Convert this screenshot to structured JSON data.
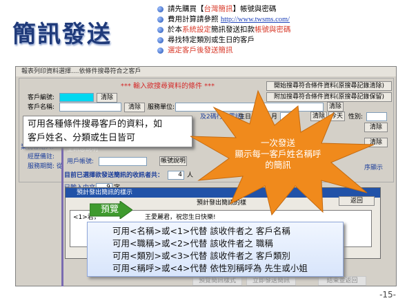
{
  "slide": {
    "title": "簡訊發送",
    "page_number": "-15-",
    "bullets": [
      {
        "parts": [
          {
            "t": "請先購買【"
          },
          {
            "t": "台灣簡訊",
            "c": "red"
          },
          {
            "t": "】帳號與密碼"
          }
        ]
      },
      {
        "parts": [
          {
            "t": "費用計算請參照 "
          },
          {
            "t": "http://www.twsms.com/",
            "c": "link"
          }
        ]
      },
      {
        "parts": [
          {
            "t": "於本"
          },
          {
            "t": "系統設定",
            "c": "red"
          },
          {
            "t": "簡訊發送扣款"
          },
          {
            "t": "帳號與密碼",
            "c": "red"
          }
        ]
      },
      {
        "parts": [
          {
            "t": "尋找特定類別或生日的客戶"
          }
        ]
      },
      {
        "parts": [
          {
            "t": "選定客戶後發送簡訊",
            "c": "red"
          }
        ]
      }
    ]
  },
  "window": {
    "title": "報表列印資料選擇....依條件搜尋符合之客戶",
    "header": "***  輸入欲搜尋資料的條件  ***",
    "btn_search_clear": "開始搜尋符合條件資料(原搜尋記錄清除)",
    "btn_search_keep": "附加搜尋符合條件資料(原搜尋記錄保留)",
    "customer_id_label": "客戶編號:",
    "customer_name_label": "客戶名稱:",
    "clear_label": "清除",
    "service_unit_label": "服務單位:",
    "phone_hint": "及2碼行動電話)",
    "birthday_label": "生日:",
    "month_label": "月",
    "today_label": "今天",
    "gender_label": "性別:",
    "business_contact_label": "業務聯絡人:",
    "manager_label": "經歷備註:",
    "service_period_label": "服務期間: 從",
    "user_account_label": "用戶帳號:",
    "account_desc_btn": "帳號說明",
    "selected_count_label": "目前已選擇欲發送簡訊的收訊者共：",
    "selected_count_value": "4",
    "person_unit": "人",
    "chars_label": "已輸入中文",
    "chars_value": "9",
    "chars_unit": "字",
    "sort_hint": "序顯示",
    "note_fragment": "主訊息說明"
  },
  "message_dialog": {
    "title": "預計發出簡訊的樣示",
    "inner_title": "預計發出簡訊的樣",
    "back_button": "返回",
    "row_tag": "<1>君，",
    "preview_text": "王愛麗君，祝您生日快樂!"
  },
  "bottom_buttons": {
    "preview": "預覽簡訊樣式",
    "send_now": "立即發送簡訊",
    "finish": "結束並返回"
  },
  "callouts": {
    "search_tip": [
      "可用各種條件搜尋客戶的資料，如",
      "客戶姓名、分類或生日皆可"
    ],
    "burst_text": [
      "一次發送",
      "顯示每一客戶姓名稱呼",
      "的簡訊"
    ],
    "preview_arrow_label": "預覽",
    "codes": [
      {
        "a": "可用<",
        "b": "名稱",
        "c": ">或<1>代替 該收件者之 ",
        "d": "客戶名稱"
      },
      {
        "a": "可用<",
        "b": "職稱",
        "c": ">或<2>代替 該收件者之 ",
        "d": "職稱"
      },
      {
        "a": "可用<",
        "b": "類別",
        "c": ">或<3>代替 該收件者之 ",
        "d": "客戶類別"
      },
      {
        "a": "可用<",
        "b": "稱呼",
        "c": ">或<4>代替 依性別稱呼為 ",
        "d": "先生或小姐"
      }
    ]
  },
  "colors": {
    "title": "#1f3a7a",
    "accent_red": "#d83a2a",
    "burst": "#f08a1c",
    "field_highlight": "#00d8f0"
  }
}
